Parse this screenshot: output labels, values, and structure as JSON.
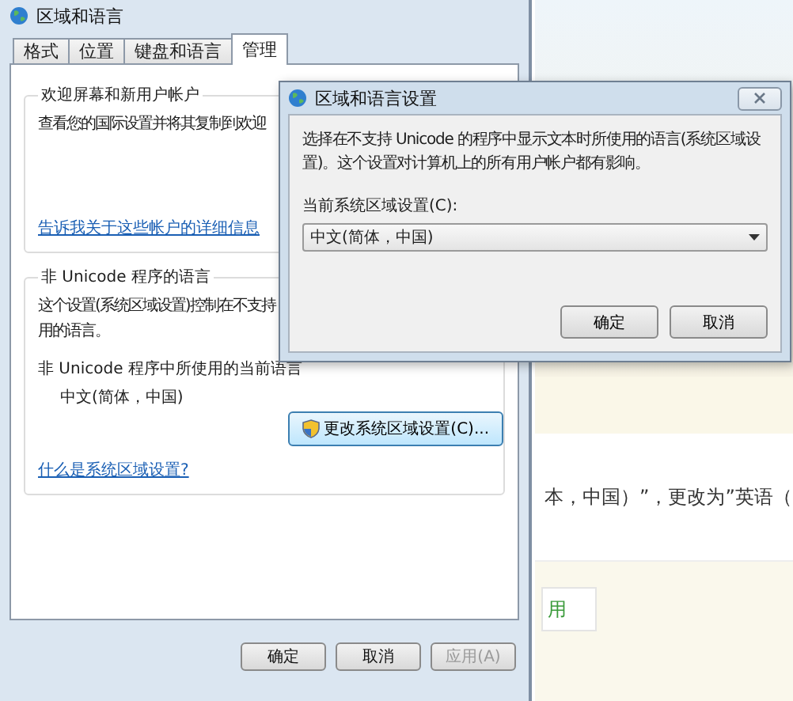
{
  "main_window": {
    "title": "区域和语言",
    "tabs": [
      {
        "label": "格式",
        "selected": false
      },
      {
        "label": "位置",
        "selected": false
      },
      {
        "label": "键盘和语言",
        "selected": false
      },
      {
        "label": "管理",
        "selected": true
      }
    ],
    "welcome_group": {
      "title": "欢迎屏幕和新用户帐户",
      "text": "查看您的国际设置并将其复制到欢迎",
      "link": "告诉我关于这些帐户的详细信息"
    },
    "unicode_group": {
      "title": "非 Unicode 程序的语言",
      "description": [
        "这个设置(系统区域设置)控制在不支持",
        "用的语言。"
      ],
      "current_label": "非 Unicode 程序中所使用的当前语言",
      "current_value": "中文(简体，中国)",
      "change_button": "更改系统区域设置(C)...",
      "link": "什么是系统区域设置?"
    },
    "buttons": [
      {
        "label": "确定",
        "disabled": false
      },
      {
        "label": "取消",
        "disabled": false
      },
      {
        "label": "应用(A)",
        "disabled": true
      }
    ]
  },
  "dialog": {
    "title": "区域和语言设置",
    "message": "选择在不支持 Unicode 的程序中显示文本时所使用的语言(系统区域设置)。这个设置对计算机上的所有用户帐户都有影响。",
    "select_label": "当前系统区域设置(C):",
    "select_value": "中文(简体，中国)",
    "buttons": [
      "确定",
      "取消"
    ]
  },
  "background_page": {
    "text": "本，中国）”，更改为”英语（",
    "tab_label": "用"
  }
}
